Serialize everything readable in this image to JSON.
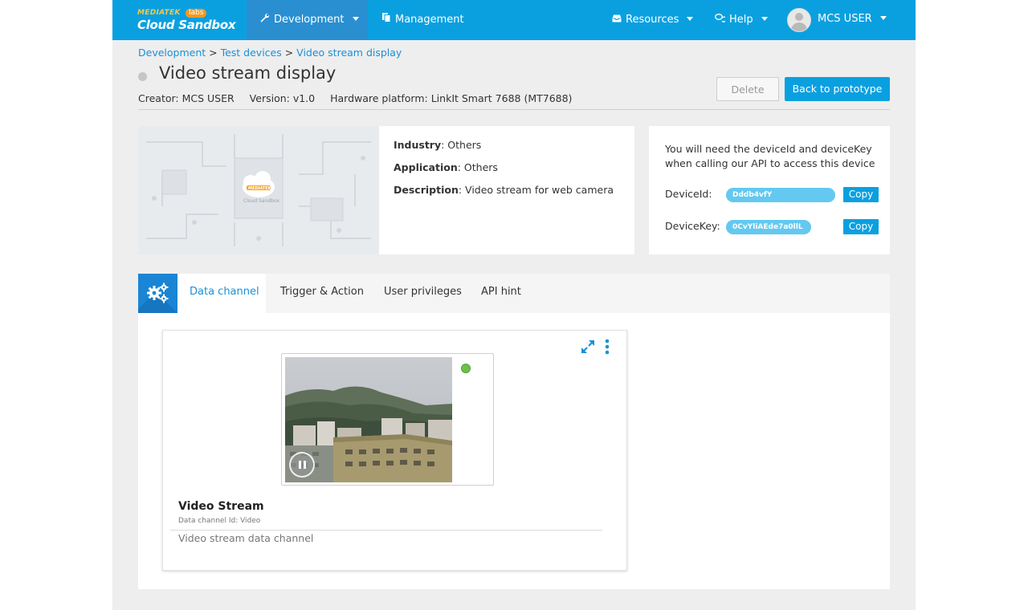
{
  "nav": {
    "brand_top": "MEDIATEK",
    "brand_labs": "labs",
    "brand_name": "Cloud Sandbox",
    "development": "Development",
    "management": "Management",
    "resources": "Resources",
    "help": "Help",
    "user": "MCS USER"
  },
  "breadcrumb": {
    "development": "Development",
    "sep1": " > ",
    "test_devices": "Test devices",
    "sep2": " > ",
    "current": "Video stream display"
  },
  "header": {
    "title": "Video stream display",
    "creator": "Creator: MCS USER",
    "version": "Version: v1.0",
    "hardware": "Hardware platform: LinkIt Smart 7688 (MT7688)",
    "delete_label": "Delete",
    "back_label": "Back to prototype"
  },
  "details": {
    "thumb_brand": "MEDIATEK",
    "thumb_caption": "Cloud Sandbox",
    "industry_label": "Industry",
    "industry_value": ": Others",
    "application_label": "Application",
    "application_value": ": Others",
    "description_label": "Description",
    "description_value": ": Video stream for web camera"
  },
  "keys": {
    "note": "You will need the deviceId and deviceKey when calling our API to access this device",
    "device_id_label": "DeviceId:",
    "device_id_value": "Dddb4vfY",
    "device_key_label": "DeviceKey:",
    "device_key_value": "0CvYliAEde7a0llL",
    "copy_label": "Copy"
  },
  "tabs": [
    {
      "label": "Data channel",
      "active": true
    },
    {
      "label": "Trigger & Action",
      "active": false
    },
    {
      "label": "User privileges",
      "active": false
    },
    {
      "label": "API hint",
      "active": false
    }
  ],
  "widget": {
    "title": "Video Stream",
    "channel_id": "Data channel Id: Video",
    "description": "Video stream data channel",
    "status": "live"
  },
  "colors": {
    "brand_blue": "#0aa0e0",
    "link_blue": "#1a90d8",
    "live_green": "#6cc04a"
  },
  "icons": [
    "wrench-icon",
    "clipboard-icon",
    "inbox-icon",
    "chat-icon",
    "caret-down-icon",
    "user-avatar-icon",
    "gears-icon",
    "expand-icon",
    "kebab-menu-icon",
    "pause-icon"
  ]
}
